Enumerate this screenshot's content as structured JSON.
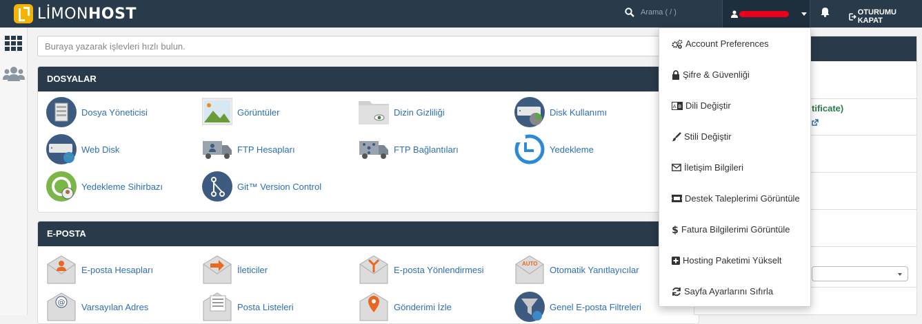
{
  "brand": {
    "logo_light": "LİMON",
    "logo_bold": "HOST"
  },
  "header": {
    "search_placeholder": "Arama ( / )",
    "logout_label": "OTURUMU KAPAT"
  },
  "quick_search": {
    "placeholder": "Buraya yazarak işlevleri hızlı bulun."
  },
  "sections": [
    {
      "title": "DOSYALAR",
      "items": [
        {
          "label": "Dosya Yöneticisi",
          "icon": "file-manager-icon"
        },
        {
          "label": "Görüntüler",
          "icon": "images-icon"
        },
        {
          "label": "Dizin Gizliliği",
          "icon": "directory-privacy-icon"
        },
        {
          "label": "Disk Kullanımı",
          "icon": "disk-usage-icon"
        },
        {
          "label": "Web Disk",
          "icon": "web-disk-icon"
        },
        {
          "label": "FTP Hesapları",
          "icon": "ftp-accounts-icon"
        },
        {
          "label": "FTP Bağlantıları",
          "icon": "ftp-connections-icon"
        },
        {
          "label": "Yedekleme",
          "icon": "backup-icon"
        },
        {
          "label": "Yedekleme Sihirbazı",
          "icon": "backup-wizard-icon"
        },
        {
          "label": "Git™ Version Control",
          "icon": "git-icon"
        }
      ]
    },
    {
      "title": "E-POSTA",
      "items": [
        {
          "label": "E-posta Hesapları",
          "icon": "email-accounts-icon"
        },
        {
          "label": "İleticiler",
          "icon": "forwarders-icon"
        },
        {
          "label": "E-posta Yönlendirmesi",
          "icon": "email-routing-icon"
        },
        {
          "label": "Otomatik Yanıtlayıcılar",
          "icon": "autoresponders-icon"
        },
        {
          "label": "Varsayılan Adres",
          "icon": "default-address-icon"
        },
        {
          "label": "Posta Listeleri",
          "icon": "mailing-lists-icon"
        },
        {
          "label": "Gönderimi İzle",
          "icon": "track-delivery-icon"
        },
        {
          "label": "Genel E-posta Filtreleri",
          "icon": "global-email-filters-icon"
        }
      ],
      "autoresponder_badge": "AUTO"
    }
  ],
  "right_column": {
    "ssl_text": "tificate)"
  },
  "user_menu": {
    "items": [
      {
        "label": "Account Preferences",
        "icon": "cogs-icon"
      },
      {
        "label": "Şifre & Güvenliği",
        "icon": "lock-icon"
      },
      {
        "label": "Dili Değiştir",
        "icon": "language-icon"
      },
      {
        "label": "Stili Değiştir",
        "icon": "paintbrush-icon"
      },
      {
        "label": "İletişim Bilgileri",
        "icon": "envelope-icon"
      },
      {
        "label": "Destek Taleplerimi Görüntüle",
        "icon": "ticket-icon"
      },
      {
        "label": "Fatura Bilgilerimi Görüntüle",
        "icon": "dollar-icon"
      },
      {
        "label": "Hosting Paketimi Yükselt",
        "icon": "plus-square-icon"
      },
      {
        "label": "Sayfa Ayarlarını Sıfırla",
        "icon": "refresh-icon"
      }
    ]
  },
  "colors": {
    "navbar": "#293a4a",
    "link": "#2e6fb5",
    "logo": "#f4b400",
    "redaction": "#e8001c"
  }
}
